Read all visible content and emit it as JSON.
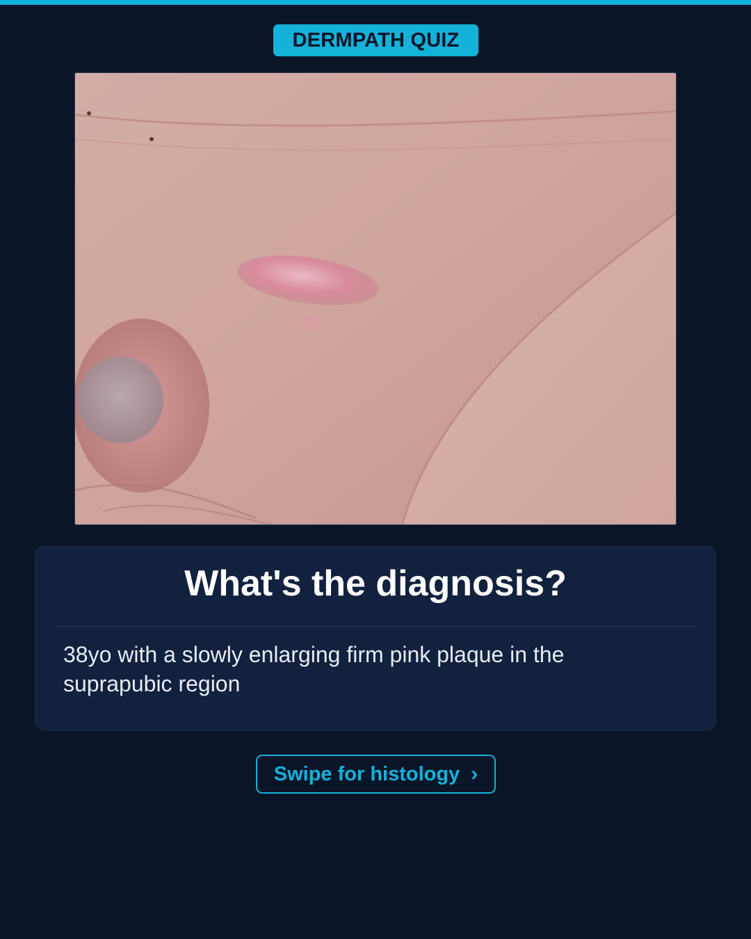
{
  "header": {
    "badge_label": "DERMPATH QUIZ",
    "accent_color": "#0fb3d8"
  },
  "photo": {
    "subject": "clinical-photo-suprapubic-pink-plaque"
  },
  "card": {
    "question": "What's the diagnosis?",
    "prompt": "38yo with a slowly enlarging firm pink plaque in the suprapubic region"
  },
  "cta": {
    "label": "Swipe for histology",
    "icon": "chevron-right-icon",
    "glyph": "›"
  },
  "colors": {
    "background": "#0b1528",
    "card": "#12213d",
    "accent": "#14b2d9"
  }
}
